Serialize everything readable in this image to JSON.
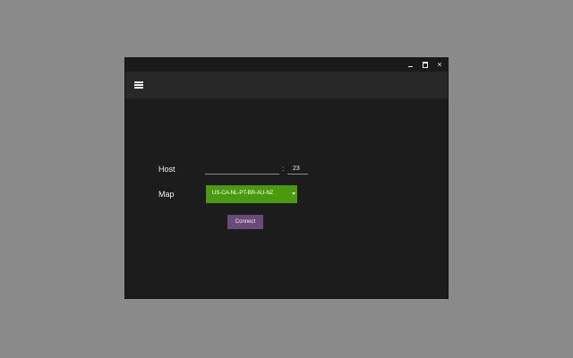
{
  "window": {
    "controls": {
      "minimize": "minimize",
      "maximize": "maximize",
      "close": "×"
    }
  },
  "toolbar": {
    "menu_icon": "hamburger-menu-icon"
  },
  "form": {
    "host_label": "Host",
    "host_value": "",
    "colon": ":",
    "port_value": "23",
    "map_label": "Map",
    "map_selected": "US-CA-NL-PT-BR-AU-NZ",
    "connect_label": "Connect"
  },
  "colors": {
    "background": "#8a8a8a",
    "window": "#1c1c1c",
    "toolbar": "#282828",
    "select": "#4a9a10",
    "button": "#6a4a78"
  }
}
